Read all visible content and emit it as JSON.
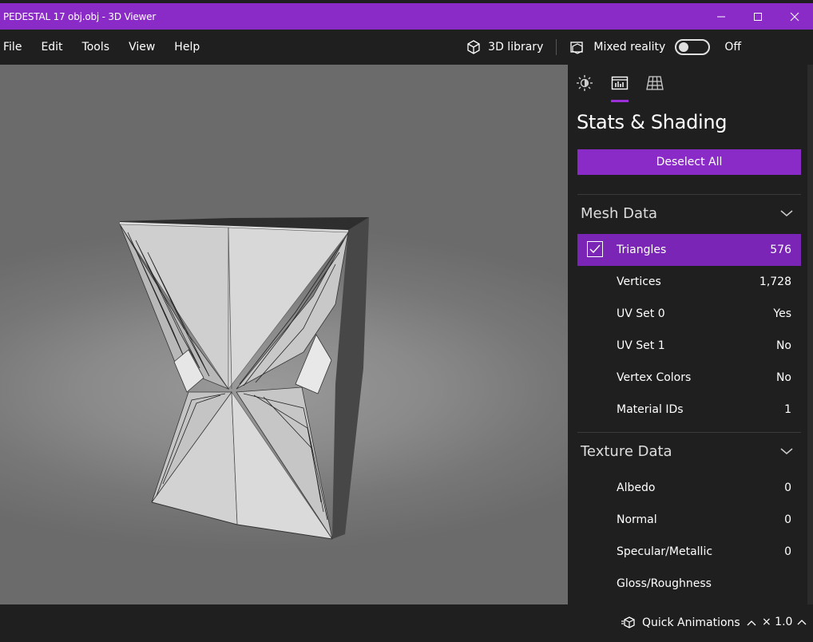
{
  "window": {
    "title": "PEDESTAL 17 obj.obj - 3D Viewer"
  },
  "menu": {
    "items": [
      "File",
      "Edit",
      "Tools",
      "View",
      "Help"
    ],
    "library_label": "3D library",
    "mixed_reality_label": "Mixed reality",
    "toggle_state": "Off"
  },
  "panel": {
    "title": "Stats & Shading",
    "deselect_label": "Deselect All",
    "mesh_section": "Mesh Data",
    "mesh_rows": [
      {
        "name": "Triangles",
        "value": "576",
        "selected": true
      },
      {
        "name": "Vertices",
        "value": "1,728"
      },
      {
        "name": "UV Set 0",
        "value": "Yes"
      },
      {
        "name": "UV Set 1",
        "value": "No"
      },
      {
        "name": "Vertex Colors",
        "value": "No"
      },
      {
        "name": "Material IDs",
        "value": "1"
      }
    ],
    "texture_section": "Texture Data",
    "texture_rows": [
      {
        "name": "Albedo",
        "value": "0"
      },
      {
        "name": "Normal",
        "value": "0"
      },
      {
        "name": "Specular/Metallic",
        "value": "0"
      },
      {
        "name": "Gloss/Roughness",
        "value": ""
      }
    ]
  },
  "bottom": {
    "quick_animations": "Quick Animations",
    "zoom": "× 1.0"
  },
  "colors": {
    "accent": "#8a2bc8",
    "selected_row": "#7a25b5",
    "background": "#1f1f1f"
  },
  "icons": {
    "lighting_tab": "sun-icon",
    "stats_tab": "chart-icon",
    "grid_tab": "grid-icon"
  }
}
